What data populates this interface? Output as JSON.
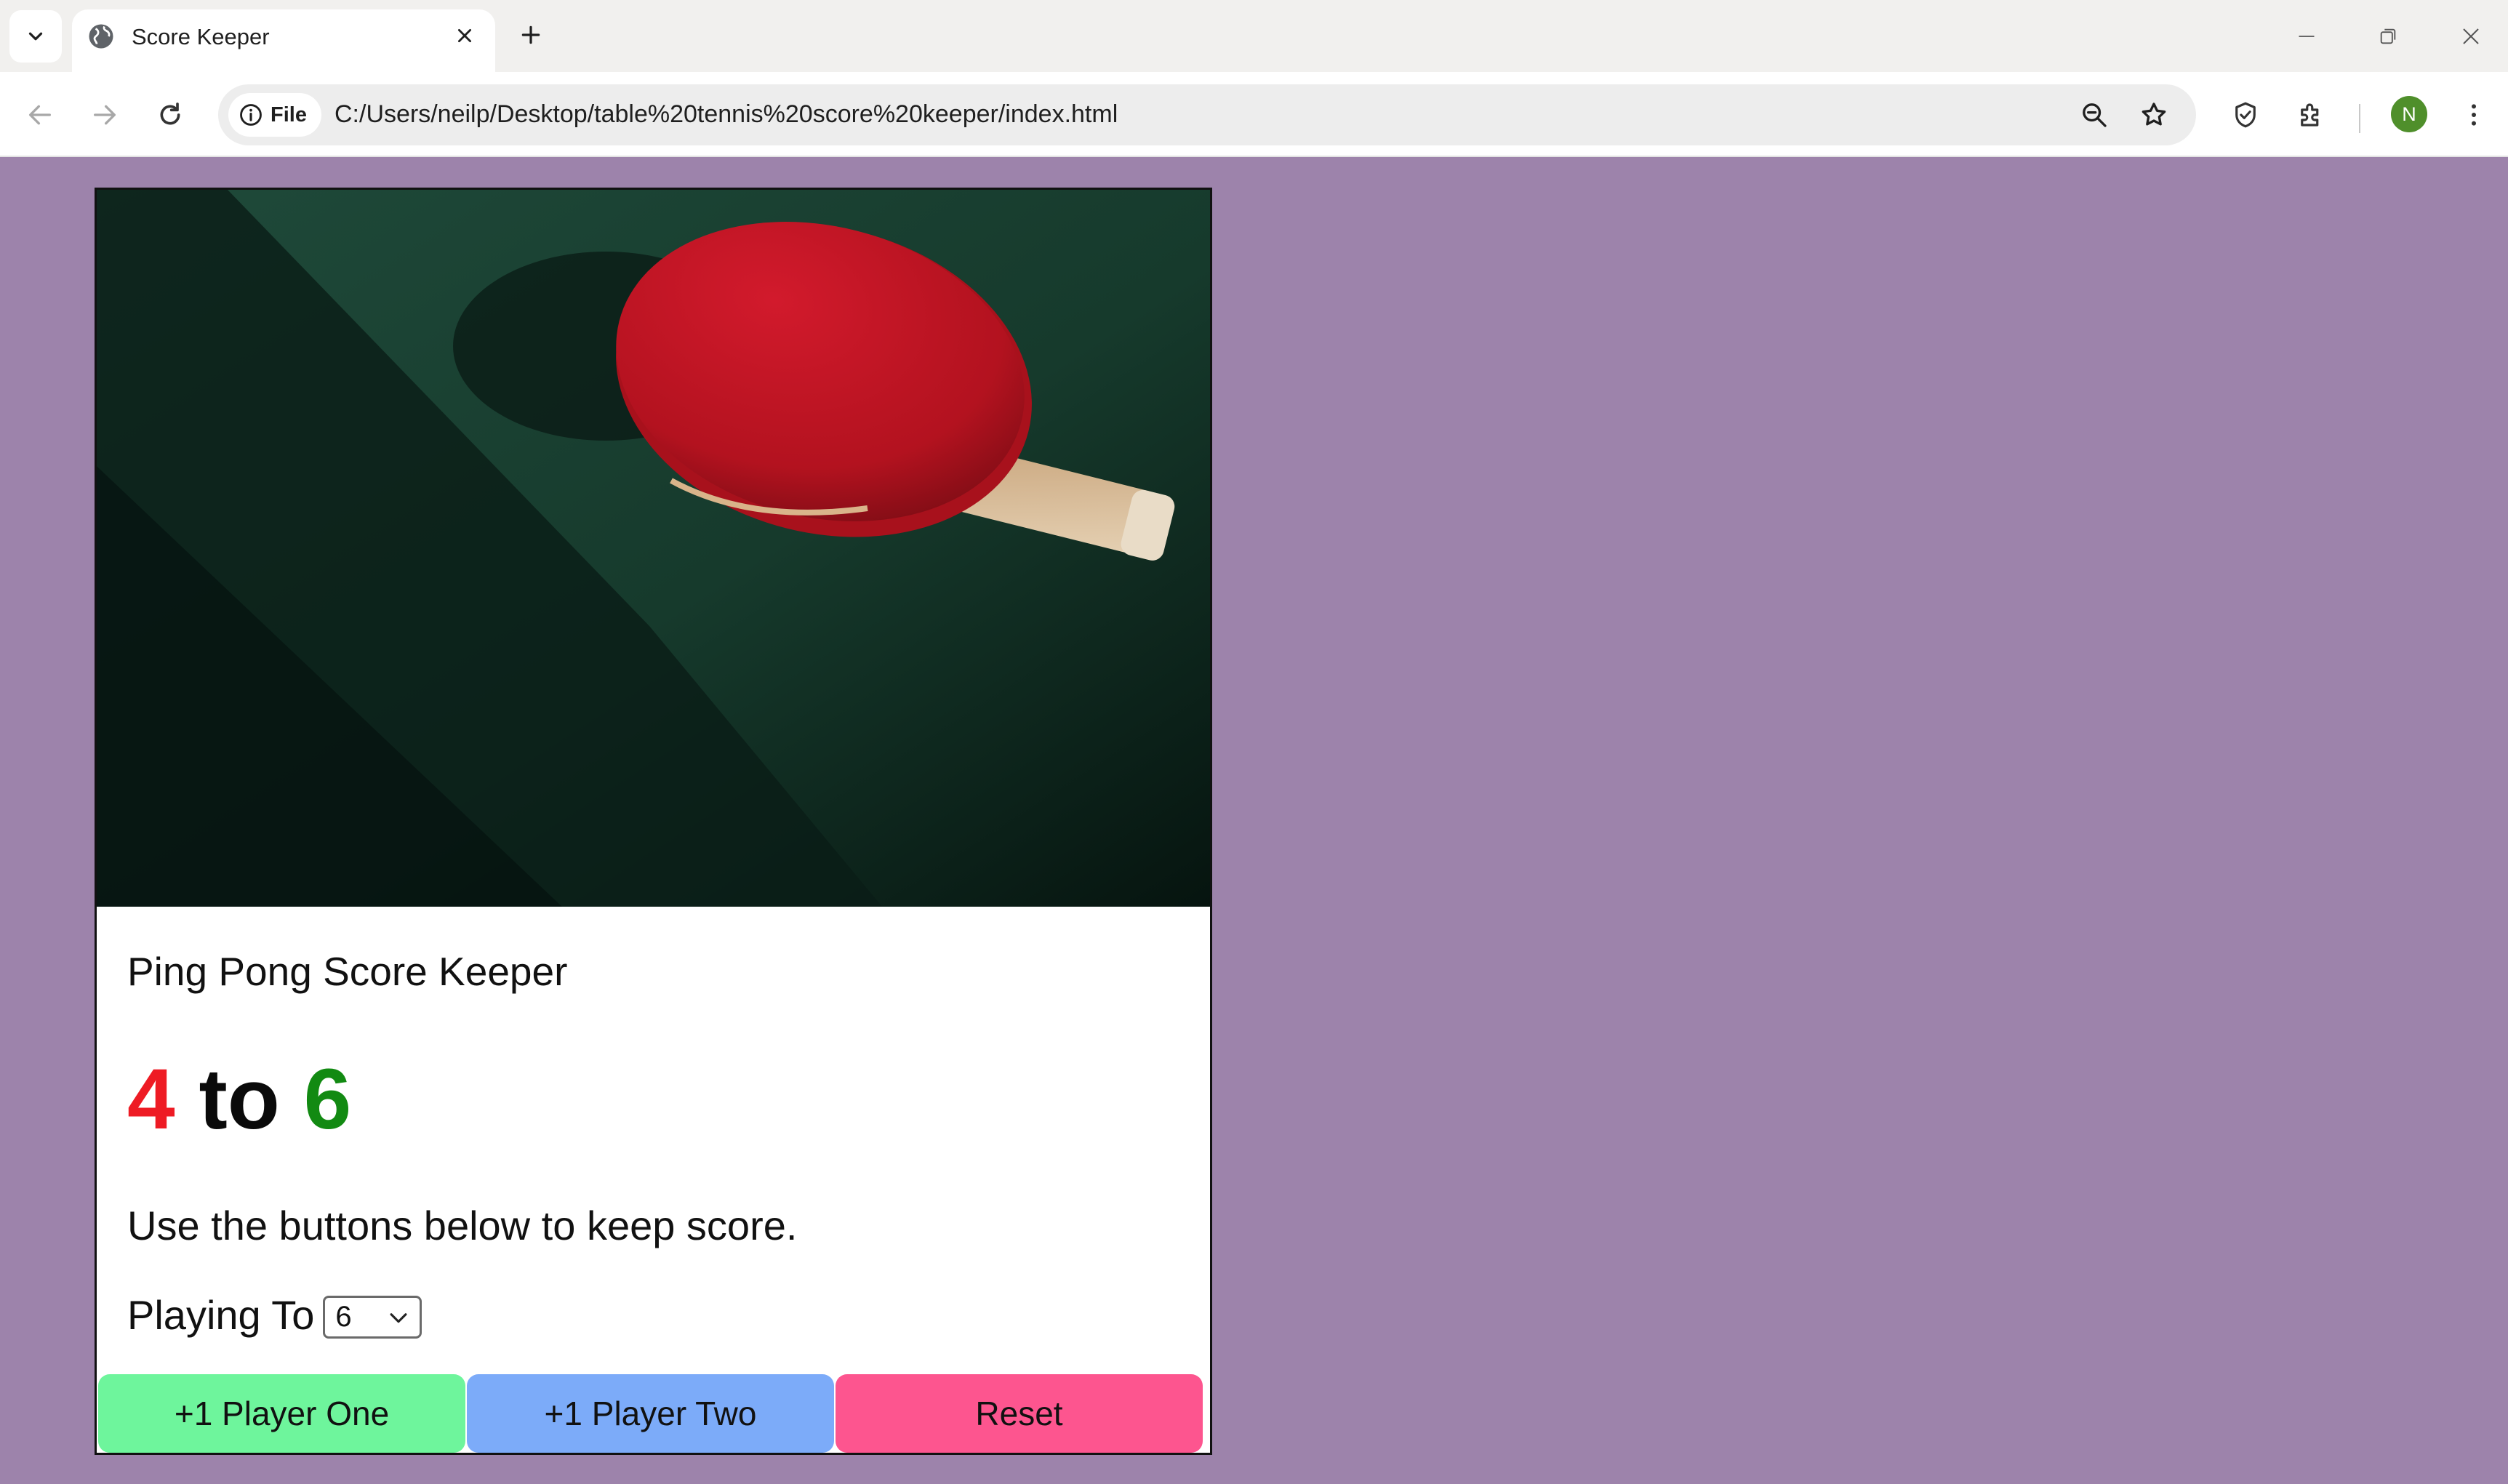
{
  "browser": {
    "tab": {
      "title": "Score Keeper"
    },
    "address_bar": {
      "chip_label": "File",
      "url": "C:/Users/neilp/Desktop/table%20tennis%20score%20keeper/index.html"
    },
    "profile_initial": "N"
  },
  "app": {
    "title": "Ping Pong Score Keeper",
    "score": {
      "player_one": "4",
      "separator": "to",
      "player_two": "6"
    },
    "colors": {
      "player_one": "#ee1b24",
      "player_two": "#128a12",
      "background": "#9d83ab"
    },
    "instructions": "Use the buttons below to keep score.",
    "playing_to": {
      "label": "Playing To",
      "value": "6"
    },
    "buttons": {
      "player_one": "+1 Player One",
      "player_two": "+1 Player Two",
      "reset": "Reset"
    },
    "button_colors": {
      "player_one": "#6ef59c",
      "player_two": "#7cabf9",
      "reset": "#fd558f"
    }
  }
}
